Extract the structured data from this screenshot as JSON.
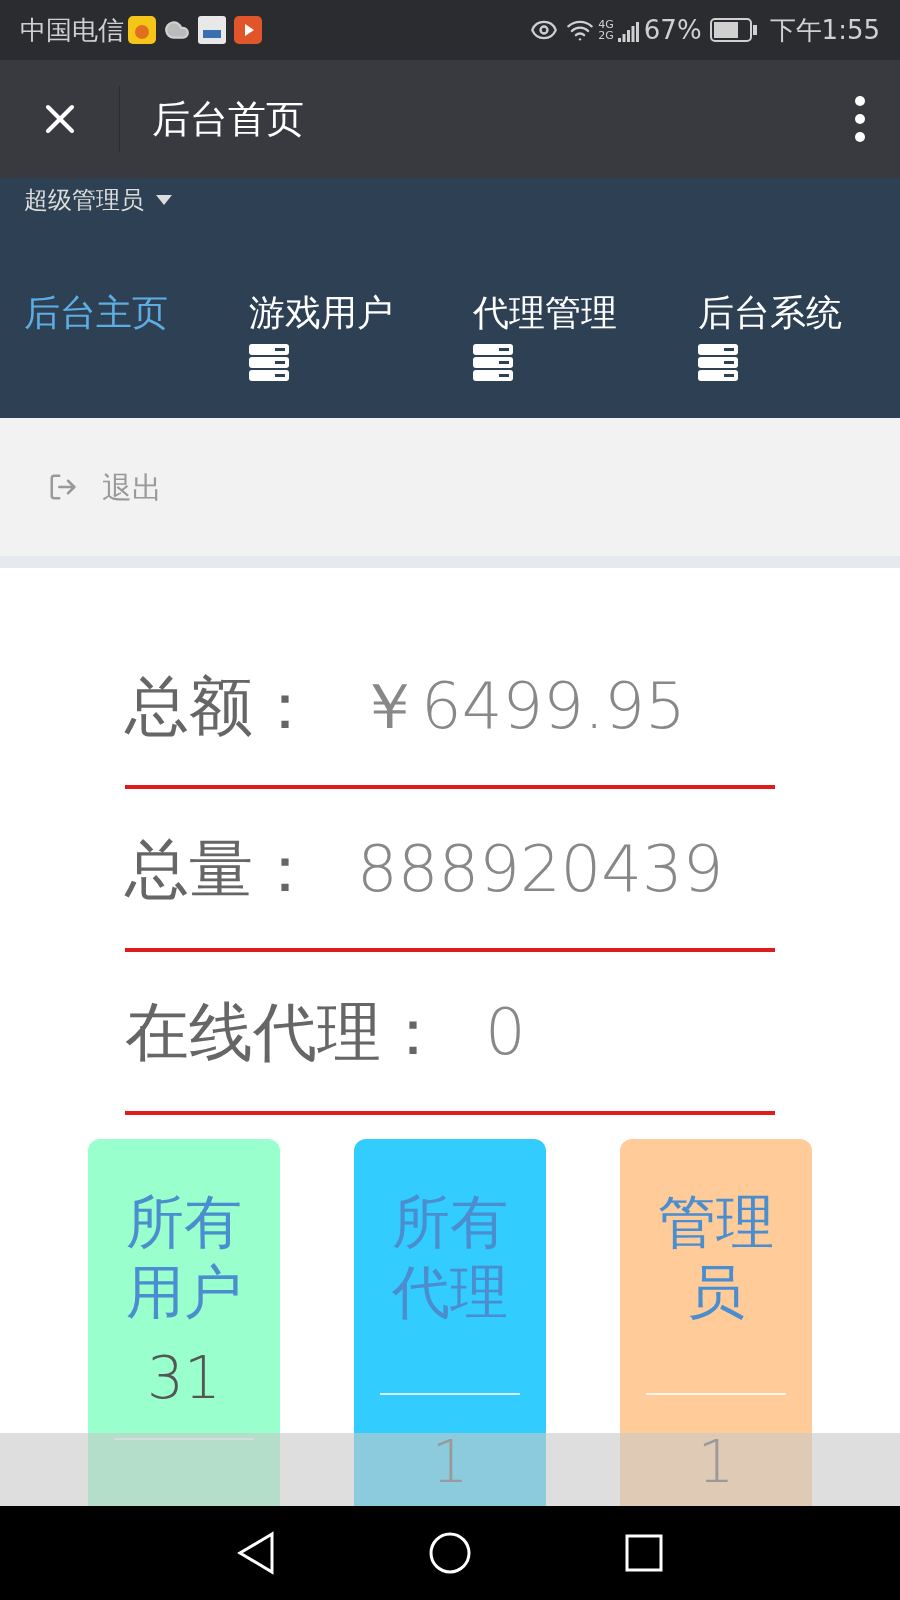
{
  "status_bar": {
    "carrier": "中国电信",
    "network": "4G\n2G",
    "battery": "67%",
    "time": "下午1:55"
  },
  "header": {
    "title": "后台首页"
  },
  "account": {
    "label": "超级管理员"
  },
  "menu": [
    {
      "label": "后台主页",
      "selected": true,
      "submenu": false
    },
    {
      "label": "游戏用户",
      "selected": false,
      "submenu": true
    },
    {
      "label": "代理管理",
      "selected": false,
      "submenu": true
    },
    {
      "label": "后台系统",
      "selected": false,
      "submenu": true
    }
  ],
  "logout": {
    "label": "退出"
  },
  "stats": [
    {
      "label": "总额：",
      "value": "￥6499.95"
    },
    {
      "label": "总量：",
      "value": "888920439"
    },
    {
      "label": "在线代理：",
      "value": "0"
    }
  ],
  "cards": [
    {
      "title": "所有用户",
      "count": "31",
      "color": "#99ffcc",
      "kind": "count-above"
    },
    {
      "title": "所有代理",
      "count": "1",
      "color": "#33ccff",
      "kind": "count-below"
    },
    {
      "title": "管理员",
      "count": "1",
      "color": "#ffcc99",
      "kind": "count-below"
    }
  ]
}
